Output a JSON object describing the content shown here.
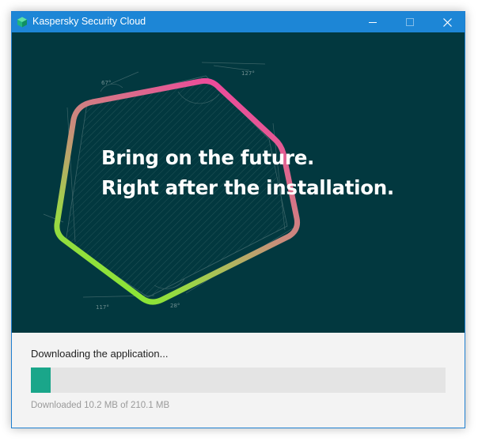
{
  "window": {
    "title": "Kaspersky Security Cloud",
    "icon": "kaspersky-logo-icon",
    "controls": {
      "minimize_icon": "minimize-icon",
      "maximize_icon": "maximize-icon",
      "close_icon": "close-icon"
    }
  },
  "hero": {
    "headline_line1": "Bring on the future.",
    "headline_line2": "Right after the installation.",
    "angle_labels": [
      "67°",
      "127°",
      "117°",
      "28°"
    ],
    "colors": {
      "background": "#02383f",
      "gradient_pink": "#e8429f",
      "gradient_green": "#7fe22b"
    }
  },
  "download": {
    "status": "Downloading the application...",
    "progress_fraction": 0.0485,
    "progress_color": "#1aa68a",
    "downloaded_text": "Downloaded 10.2 MB of 210.1 MB"
  }
}
